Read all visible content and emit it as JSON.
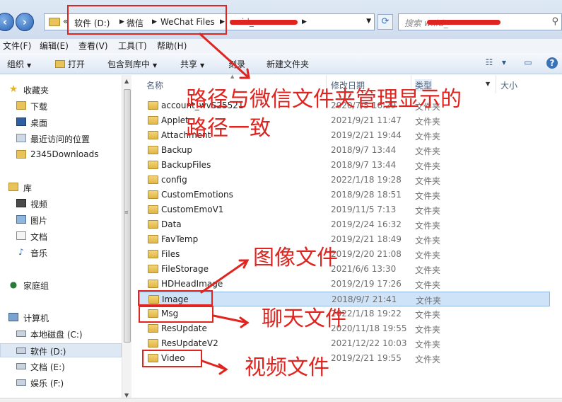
{
  "address_bar": {
    "overflow_label": "«",
    "crumbs": [
      "软件 (D:)",
      "微信",
      "WeChat Files",
      "wxid_"
    ],
    "search_placeholder": "搜索 wxid_"
  },
  "menu": [
    "文件(F)",
    "编辑(E)",
    "查看(V)",
    "工具(T)",
    "帮助(H)"
  ],
  "toolbar": {
    "organize": "组织",
    "open": "打开",
    "include_in_library": "包含到库中",
    "share": "共享",
    "burn": "刻录",
    "new_folder": "新建文件夹"
  },
  "nav": {
    "favorites": "收藏夹",
    "downloads": "下载",
    "desktop": "桌面",
    "recent": "最近访问的位置",
    "downloads2345": "2345Downloads",
    "libraries": "库",
    "videos": "视频",
    "pictures": "图片",
    "documents": "文档",
    "music": "音乐",
    "homegroup": "家庭组",
    "computer": "计算机",
    "drive_c": "本地磁盘 (C:)",
    "drive_d": "软件 (D:)",
    "drive_e": "文档 (E:)",
    "drive_f": "娱乐 (F:)"
  },
  "columns": {
    "name": "名称",
    "date": "修改日期",
    "type": "类型",
    "size": "大小"
  },
  "files": [
    {
      "name": "account_wvS25521",
      "date": "2020/7/5 16:29",
      "type": "文件夹"
    },
    {
      "name": "Applet",
      "date": "2021/9/21 11:47",
      "type": "文件夹"
    },
    {
      "name": "Attachment",
      "date": "2019/2/21 19:44",
      "type": "文件夹"
    },
    {
      "name": "Backup",
      "date": "2018/9/7 13:44",
      "type": "文件夹"
    },
    {
      "name": "BackupFiles",
      "date": "2018/9/7 13:44",
      "type": "文件夹"
    },
    {
      "name": "config",
      "date": "2022/1/18 19:28",
      "type": "文件夹"
    },
    {
      "name": "CustomEmotions",
      "date": "2018/9/28 18:51",
      "type": "文件夹"
    },
    {
      "name": "CustomEmoV1",
      "date": "2019/11/5 7:13",
      "type": "文件夹"
    },
    {
      "name": "Data",
      "date": "2019/2/24 16:32",
      "type": "文件夹"
    },
    {
      "name": "FavTemp",
      "date": "2019/2/21 18:49",
      "type": "文件夹"
    },
    {
      "name": "Files",
      "date": "2019/2/20 21:08",
      "type": "文件夹"
    },
    {
      "name": "FileStorage",
      "date": "2021/6/6 13:30",
      "type": "文件夹"
    },
    {
      "name": "HDHeadImage",
      "date": "2019/2/19 17:26",
      "type": "文件夹"
    },
    {
      "name": "Image",
      "date": "2018/9/7 21:41",
      "type": "文件夹"
    },
    {
      "name": "Msg",
      "date": "2022/1/18 19:22",
      "type": "文件夹"
    },
    {
      "name": "ResUpdate",
      "date": "2020/11/18 19:55",
      "type": "文件夹"
    },
    {
      "name": "ResUpdateV2",
      "date": "2021/12/22 10:03",
      "type": "文件夹"
    },
    {
      "name": "Video",
      "date": "2019/2/21 19:55",
      "type": "文件夹"
    }
  ],
  "annotations": {
    "path_note_line1": "路径与微信文件夹管理显示的",
    "path_note_line2": "路径一致",
    "image_note": "图像文件",
    "msg_note": "聊天文件",
    "video_note": "视频文件"
  },
  "colors": {
    "annotation_red": "#e0241f",
    "selection_blue": "#cfe3f8"
  }
}
